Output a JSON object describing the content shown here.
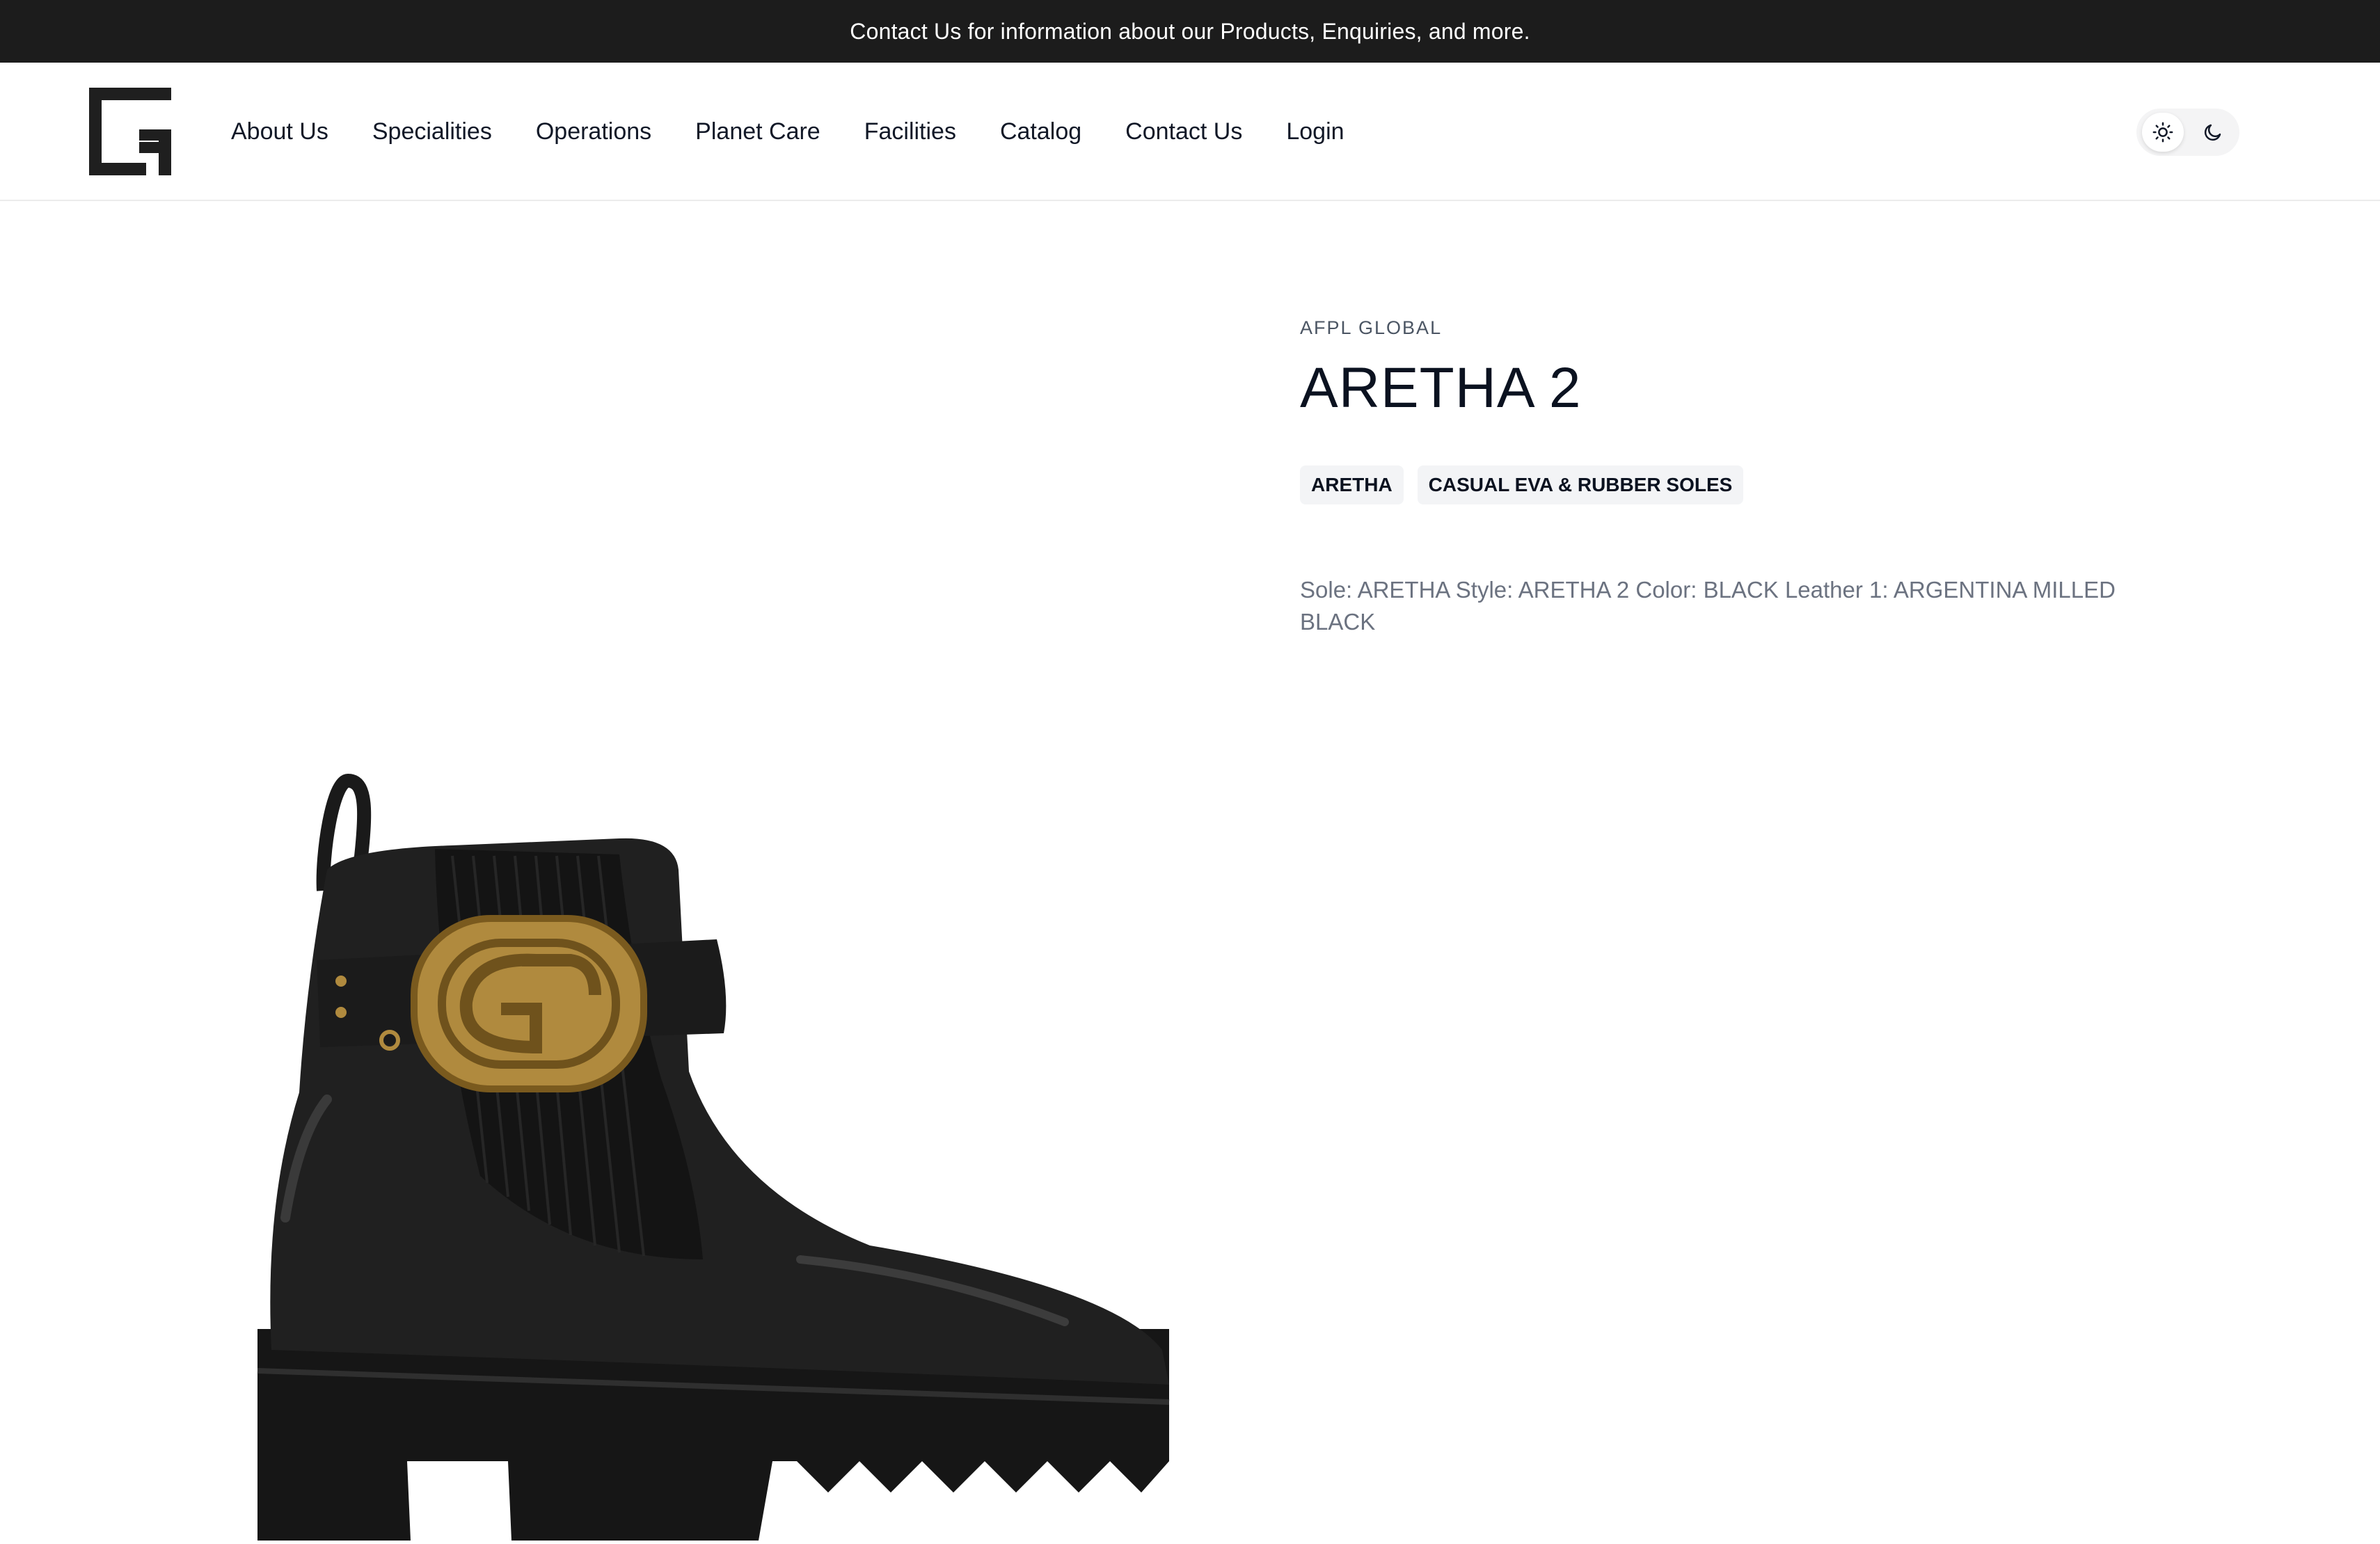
{
  "announcement": "Contact Us for information about our Products, Enquiries, and more.",
  "nav": {
    "items": [
      {
        "label": "About Us"
      },
      {
        "label": "Specialities"
      },
      {
        "label": "Operations"
      },
      {
        "label": "Planet Care"
      },
      {
        "label": "Facilities"
      },
      {
        "label": "Catalog"
      },
      {
        "label": "Contact Us"
      },
      {
        "label": "Login"
      }
    ]
  },
  "theme_toggle": {
    "light_icon": "sun-icon",
    "dark_icon": "moon-icon",
    "active": "light"
  },
  "product": {
    "brand": "AFPL GLOBAL",
    "title": "ARETHA 2",
    "tags": [
      "ARETHA",
      "CASUAL EVA & RUBBER SOLES"
    ],
    "description": "Sole: ARETHA Style: ARETHA 2 Color: BLACK Leather 1: ARGENTINA MILLED BLACK"
  },
  "colors": {
    "announcement_bg": "#1c1c1c",
    "text_primary": "#0b1220",
    "text_muted": "#6b7280",
    "tag_bg": "#f3f4f6",
    "buckle_gold": "#b08a3e"
  }
}
